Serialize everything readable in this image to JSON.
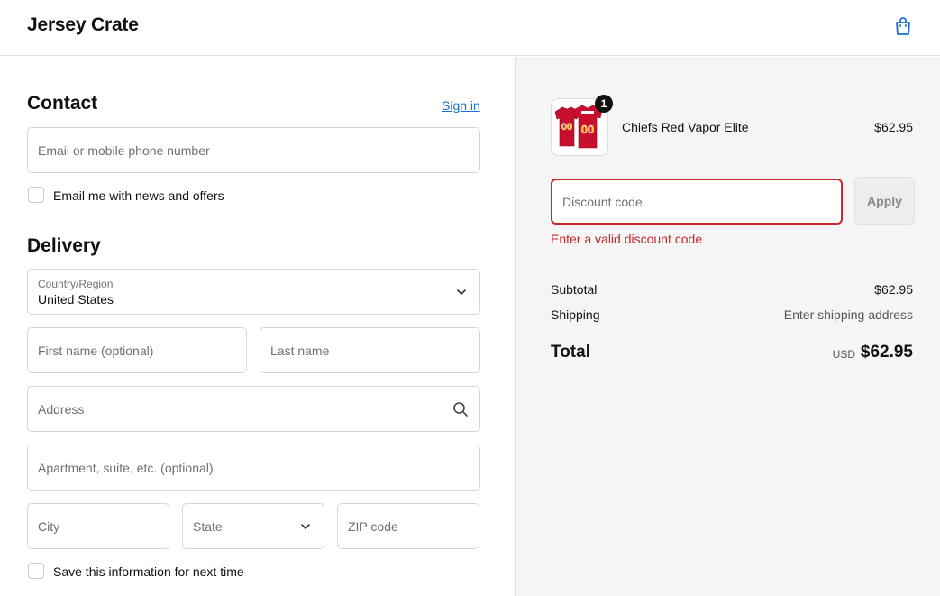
{
  "header": {
    "brand": "Jersey Crate",
    "cart_icon": "shopping-bag-icon"
  },
  "contact": {
    "heading": "Contact",
    "sign_in": "Sign in",
    "email_placeholder": "Email or mobile phone number",
    "newsletter_label": "Email me with news and offers",
    "newsletter_checked": false
  },
  "delivery": {
    "heading": "Delivery",
    "country_label": "Country/Region",
    "country_value": "United States",
    "first_name_placeholder": "First name (optional)",
    "last_name_placeholder": "Last name",
    "address_placeholder": "Address",
    "apartment_placeholder": "Apartment, suite, etc. (optional)",
    "city_placeholder": "City",
    "state_placeholder": "State",
    "zip_placeholder": "ZIP code",
    "save_info_label": "Save this information for next time",
    "save_info_checked": false
  },
  "summary": {
    "product": {
      "name": "Chiefs Red Vapor Elite",
      "price": "$62.95",
      "quantity": "1",
      "jersey_colors": [
        "#c8102e",
        "#ffb81c",
        "#ffffff"
      ]
    },
    "discount_placeholder": "Discount code",
    "apply_label": "Apply",
    "error_message": "Enter a valid discount code",
    "subtotal_label": "Subtotal",
    "subtotal_value": "$62.95",
    "shipping_label": "Shipping",
    "shipping_value": "Enter shipping address",
    "total_label": "Total",
    "currency": "USD",
    "total_value": "$62.95"
  },
  "colors": {
    "error": "#c5282a",
    "link": "#1a6fd0",
    "summary_bg": "#f5f5f5"
  }
}
